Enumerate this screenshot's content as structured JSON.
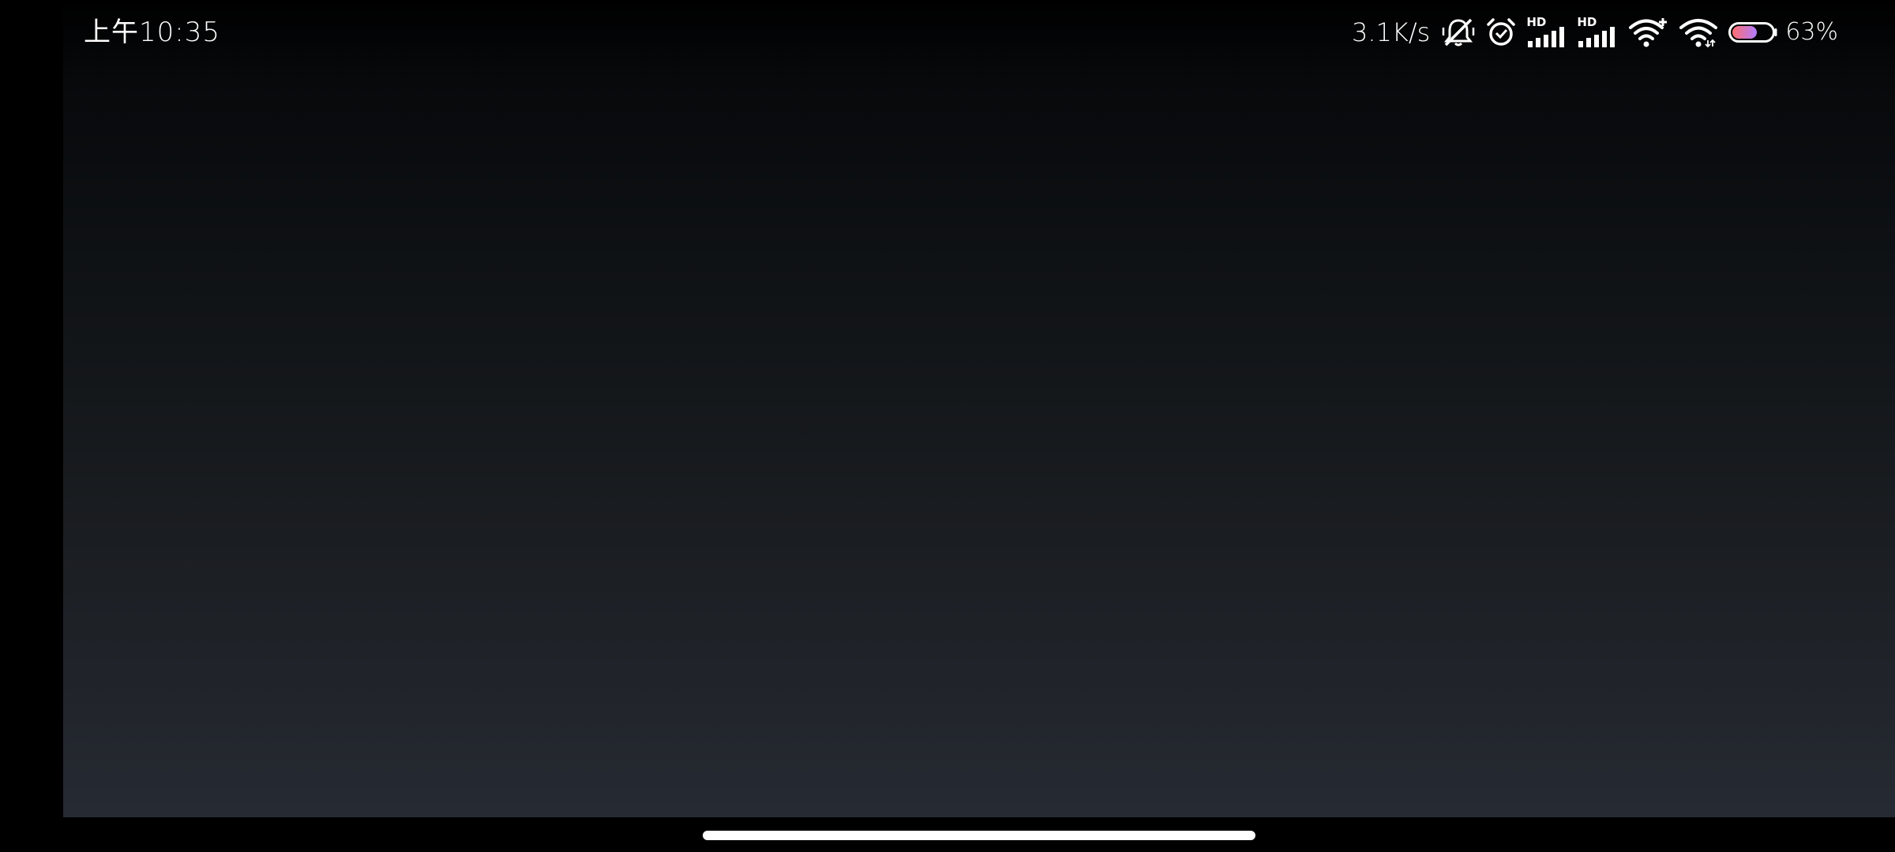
{
  "status_bar": {
    "time": "上午10:35",
    "network_speed": "3.1K/s",
    "battery_percent": "63%",
    "battery_level": 0.63,
    "icons": [
      "notifications-muted-icon",
      "alarm-icon",
      "hd-cellular-signal-icon",
      "hd-cellular-signal-icon",
      "wifi-plus-icon",
      "wifi-icon",
      "battery-icon"
    ],
    "hd_label": "HD"
  },
  "colors": {
    "background": "#000000",
    "content_top": "#000000",
    "content_bottom": "#262a32",
    "icon": "#ffffff",
    "battery_fill_start": "#ff6f6f",
    "battery_fill_end": "#b07cff",
    "nav_handle": "#ffffff"
  }
}
